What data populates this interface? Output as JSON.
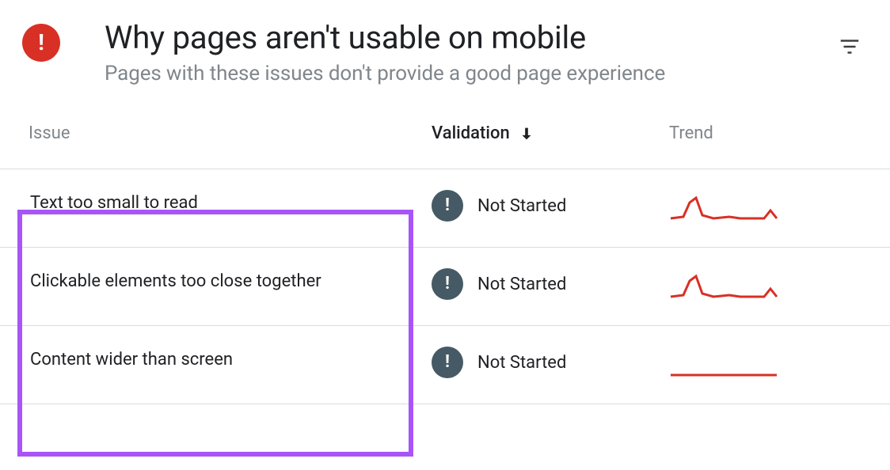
{
  "header": {
    "title": "Why pages aren't usable on mobile",
    "subtitle": "Pages with these issues don't provide a good page experience"
  },
  "columns": {
    "issue": "Issue",
    "validation": "Validation",
    "trend": "Trend"
  },
  "rows": [
    {
      "issue": "Text too small to read",
      "validation": "Not Started",
      "trend": "spike"
    },
    {
      "issue": "Clickable elements too close together",
      "validation": "Not Started",
      "trend": "spike"
    },
    {
      "issue": "Content wider than screen",
      "validation": "Not Started",
      "trend": "flat"
    }
  ]
}
